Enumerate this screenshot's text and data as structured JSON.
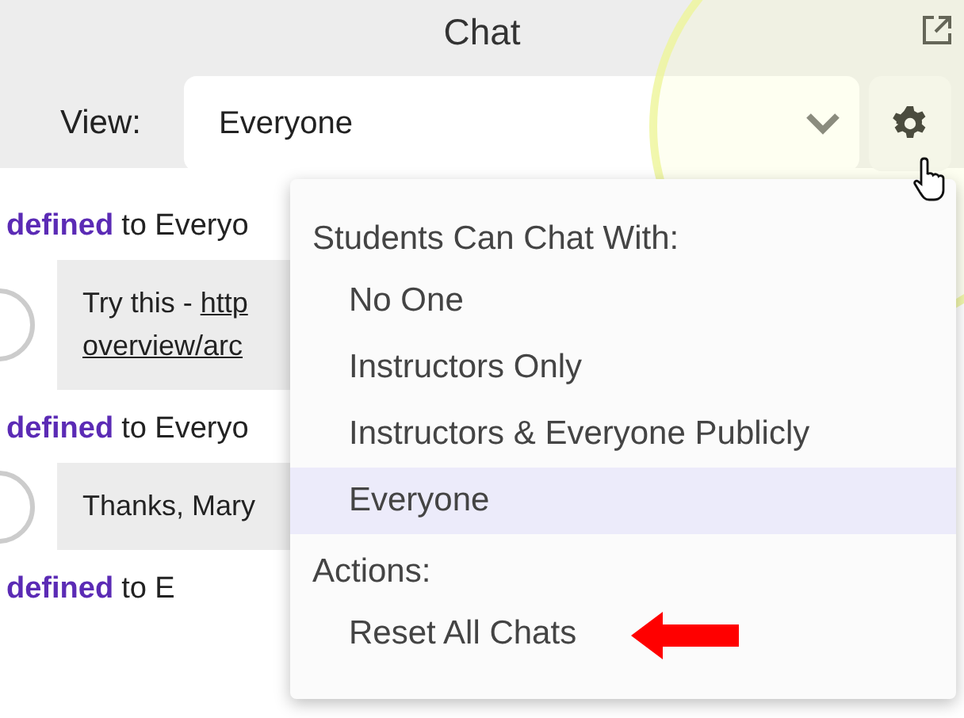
{
  "window": {
    "title": "Chat"
  },
  "view": {
    "label": "View:",
    "value": "Everyone"
  },
  "messages": [
    {
      "sender": "defined",
      "recipient": "to Everyo",
      "body": [
        {
          "text": "Try this - ",
          "link": "http"
        },
        {
          "link": "overview/arc"
        }
      ]
    },
    {
      "sender": "defined",
      "recipient": "to Everyo",
      "body": [
        {
          "text": "Thanks, Mary"
        }
      ]
    },
    {
      "sender": "defined",
      "recipient": "to E"
    }
  ],
  "menu": {
    "sections": [
      {
        "heading": "Students Can Chat With:",
        "items": [
          {
            "label": "No One",
            "selected": false,
            "annotated": false
          },
          {
            "label": "Instructors Only",
            "selected": false,
            "annotated": false
          },
          {
            "label": "Instructors & Everyone Publicly",
            "selected": false,
            "annotated": false
          },
          {
            "label": "Everyone",
            "selected": true,
            "annotated": false
          }
        ]
      },
      {
        "heading": "Actions:",
        "items": [
          {
            "label": "Reset All Chats",
            "selected": false,
            "annotated": true
          }
        ]
      }
    ]
  }
}
